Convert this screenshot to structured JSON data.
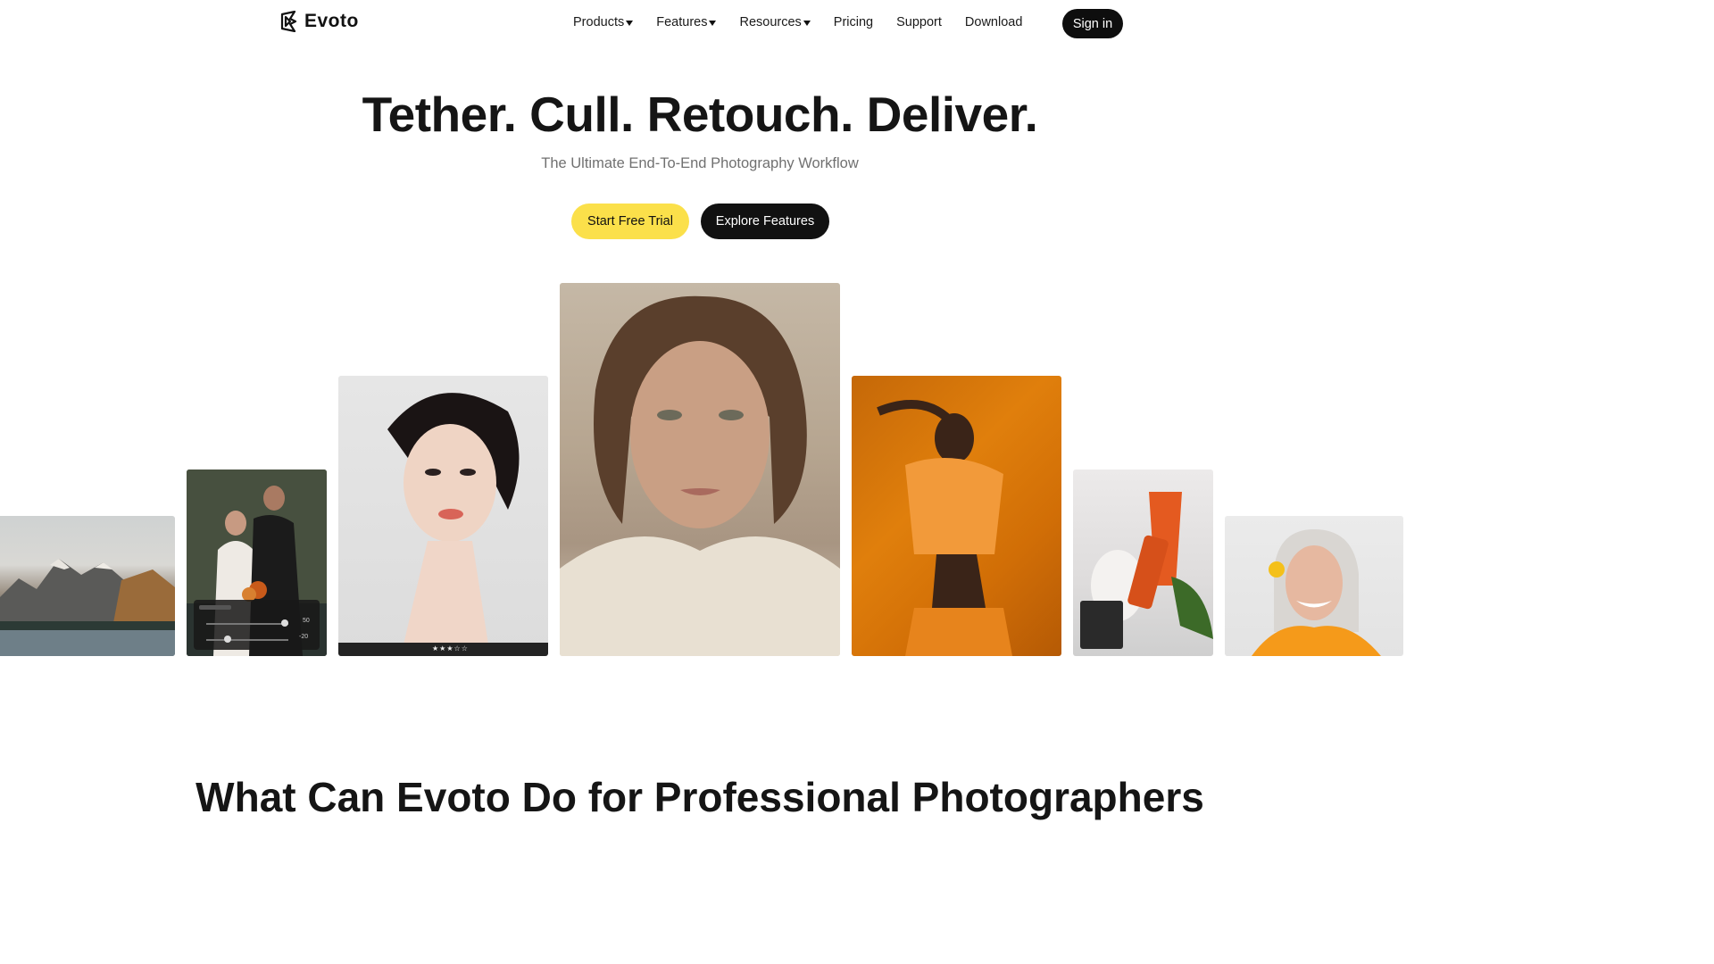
{
  "brand": {
    "name": "Evoto",
    "logo_icon": "evoto-logo-icon"
  },
  "nav": {
    "items": [
      {
        "label": "Products",
        "dropdown": true
      },
      {
        "label": "Features",
        "dropdown": true
      },
      {
        "label": "Resources",
        "dropdown": true
      },
      {
        "label": "Pricing",
        "dropdown": false
      },
      {
        "label": "Support",
        "dropdown": false
      },
      {
        "label": "Download",
        "dropdown": false
      }
    ],
    "signin_label": "Sign in"
  },
  "hero": {
    "title": "Tether. Cull. Retouch. Deliver.",
    "subtitle": "The Ultimate End-To-End Photography Workflow",
    "primary_cta": "Start Free Trial",
    "secondary_cta": "Explore Features"
  },
  "gallery": {
    "images": [
      {
        "name": "mountain-lake-photo"
      },
      {
        "name": "wedding-couple-photo",
        "overlay_values": [
          "50",
          "-20"
        ]
      },
      {
        "name": "asian-woman-portrait-photo",
        "rating_stars": 3,
        "rating_max": 5
      },
      {
        "name": "woman-portrait-main-photo"
      },
      {
        "name": "orange-fashion-photo"
      },
      {
        "name": "skincare-product-photo"
      },
      {
        "name": "older-woman-portrait-photo"
      }
    ]
  },
  "section": {
    "title": "What Can Evoto Do for Professional Photographers"
  },
  "colors": {
    "accent": "#fbe04a",
    "dark": "#111111",
    "muted_text": "#707070"
  }
}
